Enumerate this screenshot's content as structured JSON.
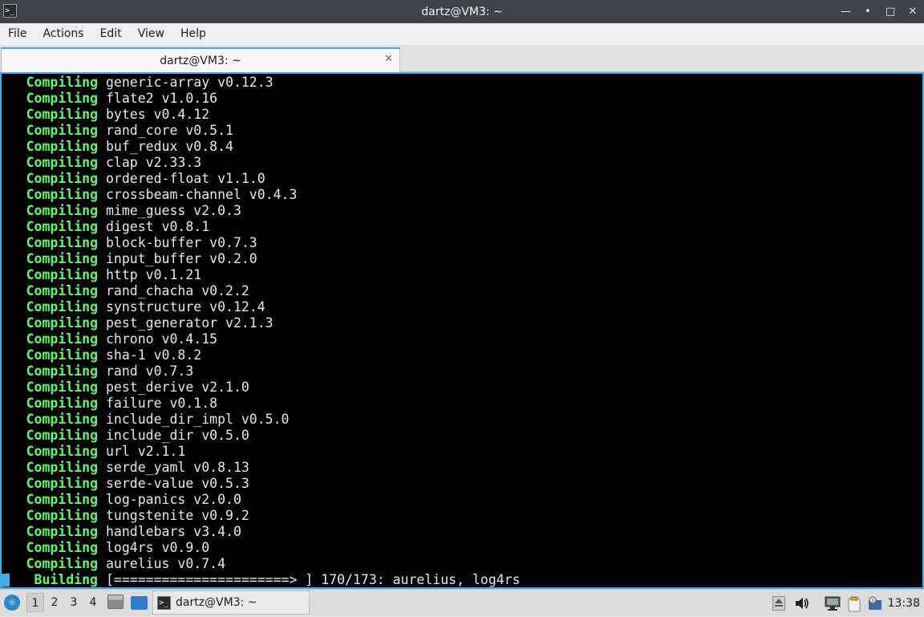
{
  "window": {
    "title": "dartz@VM3: ~",
    "app_icon": "terminal-icon",
    "app_icon_glyph": ">_",
    "buttons": {
      "minimize": "—",
      "restore": "•",
      "maximize": "□",
      "close": "✕"
    }
  },
  "menubar": {
    "items": [
      "File",
      "Actions",
      "Edit",
      "View",
      "Help"
    ]
  },
  "tabs": [
    {
      "label": "dartz@VM3: ~",
      "close": "✕"
    }
  ],
  "terminal": {
    "lines": [
      {
        "kw": "Compiling",
        "text": "generic-array v0.12.3"
      },
      {
        "kw": "Compiling",
        "text": "flate2 v1.0.16"
      },
      {
        "kw": "Compiling",
        "text": "bytes v0.4.12"
      },
      {
        "kw": "Compiling",
        "text": "rand_core v0.5.1"
      },
      {
        "kw": "Compiling",
        "text": "buf_redux v0.8.4"
      },
      {
        "kw": "Compiling",
        "text": "clap v2.33.3"
      },
      {
        "kw": "Compiling",
        "text": "ordered-float v1.1.0"
      },
      {
        "kw": "Compiling",
        "text": "crossbeam-channel v0.4.3"
      },
      {
        "kw": "Compiling",
        "text": "mime_guess v2.0.3"
      },
      {
        "kw": "Compiling",
        "text": "digest v0.8.1"
      },
      {
        "kw": "Compiling",
        "text": "block-buffer v0.7.3"
      },
      {
        "kw": "Compiling",
        "text": "input_buffer v0.2.0"
      },
      {
        "kw": "Compiling",
        "text": "http v0.1.21"
      },
      {
        "kw": "Compiling",
        "text": "rand_chacha v0.2.2"
      },
      {
        "kw": "Compiling",
        "text": "synstructure v0.12.4"
      },
      {
        "kw": "Compiling",
        "text": "pest_generator v2.1.3"
      },
      {
        "kw": "Compiling",
        "text": "chrono v0.4.15"
      },
      {
        "kw": "Compiling",
        "text": "sha-1 v0.8.2"
      },
      {
        "kw": "Compiling",
        "text": "rand v0.7.3"
      },
      {
        "kw": "Compiling",
        "text": "pest_derive v2.1.0"
      },
      {
        "kw": "Compiling",
        "text": "failure v0.1.8"
      },
      {
        "kw": "Compiling",
        "text": "include_dir_impl v0.5.0"
      },
      {
        "kw": "Compiling",
        "text": "include_dir v0.5.0"
      },
      {
        "kw": "Compiling",
        "text": "url v2.1.1"
      },
      {
        "kw": "Compiling",
        "text": "serde_yaml v0.8.13"
      },
      {
        "kw": "Compiling",
        "text": "serde-value v0.5.3"
      },
      {
        "kw": "Compiling",
        "text": "log-panics v2.0.0"
      },
      {
        "kw": "Compiling",
        "text": "tungstenite v0.9.2"
      },
      {
        "kw": "Compiling",
        "text": "handlebars v3.4.0"
      },
      {
        "kw": "Compiling",
        "text": "log4rs v0.9.0"
      },
      {
        "kw": "Compiling",
        "text": "aurelius v0.7.4"
      },
      {
        "kw": "Building",
        "text": "[======================> ] 170/173: aurelius, log4rs"
      }
    ],
    "keyword_color": "#5ff967",
    "text_color": "#e8e8e8",
    "cursor_color": "#3daee9"
  },
  "taskbar": {
    "start_icon": "lxqt-start-icon",
    "desktops": [
      "1",
      "2",
      "3",
      "4"
    ],
    "active_desktop": "1",
    "quicklaunch": [
      "file-manager-icon",
      "show-desktop-icon"
    ],
    "task": {
      "label": "dartz@VM3: ~",
      "icon": "terminal-icon",
      "icon_glyph": ">_"
    },
    "tray": [
      "eject-icon",
      "volume-icon",
      "network-icon",
      "clipboard-icon",
      "update-notifier-icon"
    ],
    "clock": "13:38"
  },
  "colors": {
    "accent": "#3daee9",
    "titlebar": "#404449",
    "terminal_bg": "#000000"
  }
}
